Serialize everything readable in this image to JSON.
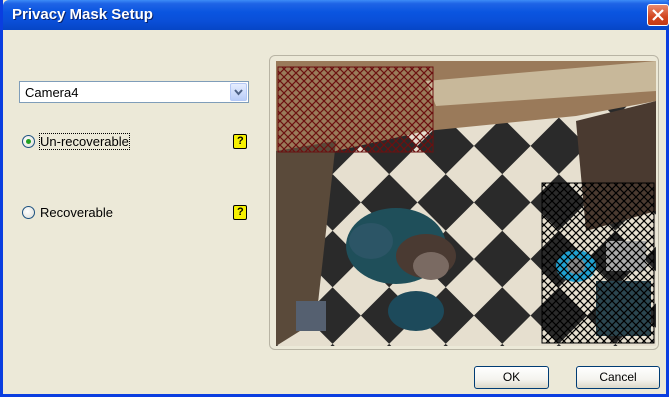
{
  "dialog": {
    "title": "Privacy Mask Setup"
  },
  "camera_select": {
    "value": "Camera4",
    "icon": "chevron-down-icon"
  },
  "mask_mode": {
    "selected": "unrecoverable",
    "options": [
      {
        "label": "Un-recoverable"
      },
      {
        "label": "Recoverable"
      }
    ],
    "help_label": "?"
  },
  "buttons": {
    "ok": "OK",
    "cancel": "Cancel"
  },
  "colors": {
    "titlebar": "#0a55e0",
    "mask_red": "#8b1a1a",
    "mask_black": "#000000",
    "help_icon": "#f6f000"
  }
}
